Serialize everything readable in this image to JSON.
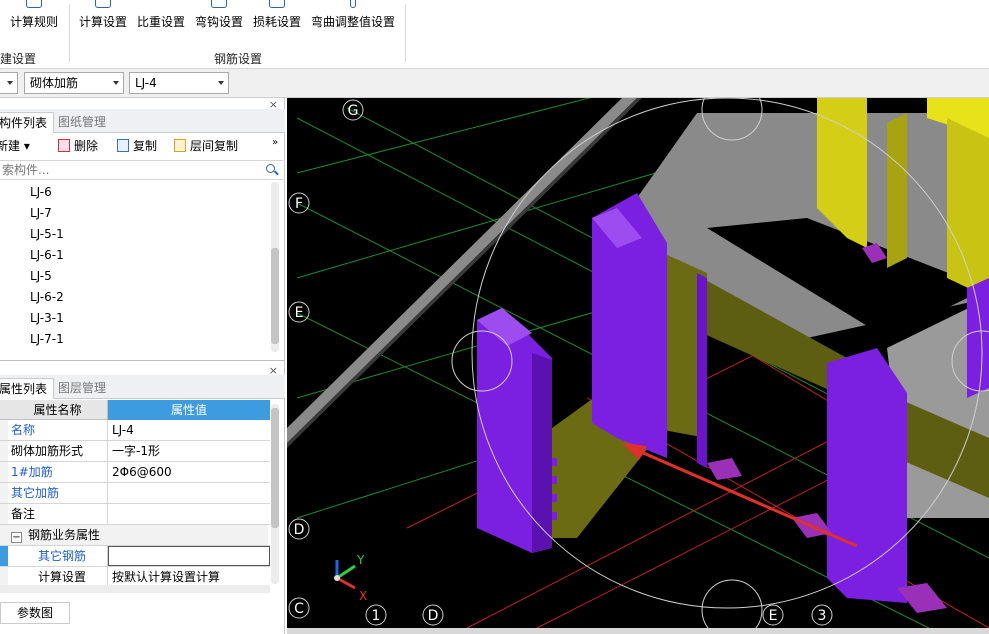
{
  "ribbon": {
    "left_button": "计算规则",
    "left_group": "建设置",
    "buttons": [
      "计算设置",
      "比重设置",
      "弯钩设置",
      "损耗设置",
      "弯曲调整值设置"
    ],
    "group_label": "钢筋设置"
  },
  "selectors": {
    "category": "砌体加筋",
    "element": "LJ-4"
  },
  "component_panel": {
    "tabs": [
      "构件列表",
      "图纸管理"
    ],
    "close": "×",
    "toolbar": {
      "new": "新建",
      "delete": "删除",
      "copy": "复制",
      "floor_copy": "层间复制",
      "more": "»"
    },
    "search_placeholder": "索构件...",
    "items": [
      "LJ-6",
      "LJ-7",
      "LJ-5-1",
      "LJ-6-1",
      "LJ-5",
      "LJ-6-2",
      "LJ-3-1",
      "LJ-7-1"
    ]
  },
  "property_panel": {
    "tabs": [
      "属性列表",
      "图层管理"
    ],
    "close": "×",
    "header": {
      "name": "属性名称",
      "value": "属性值"
    },
    "rows": [
      {
        "name": "名称",
        "value": "LJ-4"
      },
      {
        "name": "砌体加筋形式",
        "value": "一字-1形"
      },
      {
        "name": "1#加筋",
        "value": "2Φ6@600"
      },
      {
        "name": "其它加筋",
        "value": ""
      },
      {
        "name": "备注",
        "value": ""
      }
    ],
    "group": {
      "toggle": "−",
      "label": "钢筋业务属性"
    },
    "sub_rows": [
      {
        "name": "其它钢筋",
        "value": ""
      },
      {
        "name": "计算设置",
        "value": "按默认计算设置计算"
      }
    ]
  },
  "bottom_tab": "参数图",
  "viewport": {
    "axis_labels": [
      "G",
      "F",
      "E",
      "D",
      "C",
      "1",
      "D",
      "E",
      "3"
    ],
    "axis_x": "X",
    "axis_y": "Y",
    "colors": {
      "background": "#000000",
      "column": "#7b1fe0",
      "wall_grey": "#8a8a8a",
      "beam_olive": "#6b6b14",
      "yellow": "#e8e21a",
      "grid_green": "#1e8a2a",
      "grid_red": "#c02020",
      "arrow": "#e0302a"
    }
  }
}
